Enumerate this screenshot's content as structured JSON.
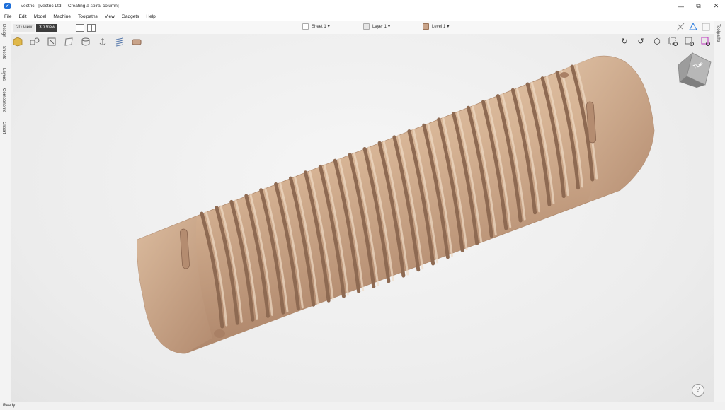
{
  "window": {
    "title": "Vectric - [Vectric Ltd] - [Creating a spiral column]",
    "app_icon_glyph": "✔",
    "controls": [
      "—",
      "⧉",
      "✕"
    ]
  },
  "menu": [
    "File",
    "Edit",
    "Model",
    "Machine",
    "Toolpaths",
    "View",
    "Gadgets",
    "Help"
  ],
  "left_tabs": [
    "Design",
    "Sheets",
    "Layers",
    "Components",
    "Clipart"
  ],
  "right_tabs": [
    "Toolpaths"
  ],
  "view_toolbar": {
    "view_2d": "2D View",
    "view_3d": "3D View",
    "sheet": "Sheet 1",
    "layer": "Layer 1",
    "level": "Level 1"
  },
  "tools": [
    "material-block-icon",
    "shapes-icon",
    "toolpath-icon",
    "sheet-icon",
    "cylinder-icon",
    "anchor-icon",
    "lines-icon",
    "brick-icon"
  ],
  "nav_tools": [
    "rotate-left-icon",
    "rotate-right-icon",
    "cube-view-icon",
    "zoom-area-icon",
    "zoom-fit-icon",
    "zoom-select-icon"
  ],
  "view_cube": {
    "label": "TOP"
  },
  "status": "Ready",
  "help_label": "?",
  "colors": {
    "wood_light": "#e4c4a4",
    "wood_mid": "#cfa788",
    "wood_dark": "#9b7459",
    "accent": "#1e6fd9"
  }
}
